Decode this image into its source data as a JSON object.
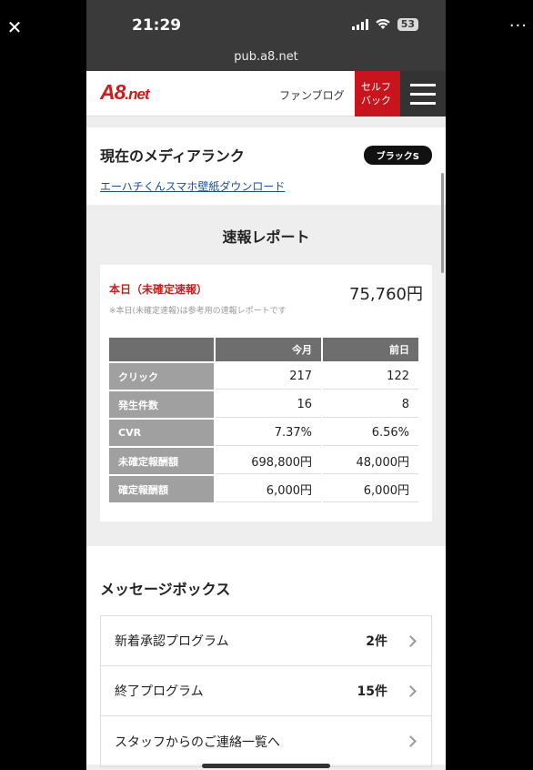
{
  "status": {
    "time": "21:29",
    "battery": "53"
  },
  "browser": {
    "url": "pub.a8.net"
  },
  "header": {
    "logo_main": "A8",
    "logo_suffix": ".net",
    "fan_blog": "ファンブログ",
    "self_back_line1": "セルフ",
    "self_back_line2": "バック"
  },
  "rank": {
    "title": "現在のメディアランク",
    "badge": "ブラックS",
    "link": "エーハチくんスマホ壁紙ダウンロード"
  },
  "report": {
    "title": "速報レポート",
    "today_label": "本日（未確定速報）",
    "today_amount": "75,760円",
    "note": "※本日(未確定速報)は参考用の速報レポートです",
    "columns": [
      "今月",
      "前日"
    ],
    "rows": [
      {
        "label": "クリック",
        "month": "217",
        "prev": "122"
      },
      {
        "label": "発生件数",
        "month": "16",
        "prev": "8"
      },
      {
        "label": "CVR",
        "month": "7.37%",
        "prev": "6.56%"
      },
      {
        "label": "未確定報酬額",
        "month": "698,800円",
        "prev": "48,000円"
      },
      {
        "label": "確定報酬額",
        "month": "6,000円",
        "prev": "6,000円"
      }
    ]
  },
  "messages": {
    "title": "メッセージボックス",
    "items": [
      {
        "label": "新着承認プログラム",
        "count": "2件"
      },
      {
        "label": "終了プログラム",
        "count": "15件"
      },
      {
        "label": "スタッフからのご連絡一覧へ",
        "count": ""
      }
    ]
  }
}
